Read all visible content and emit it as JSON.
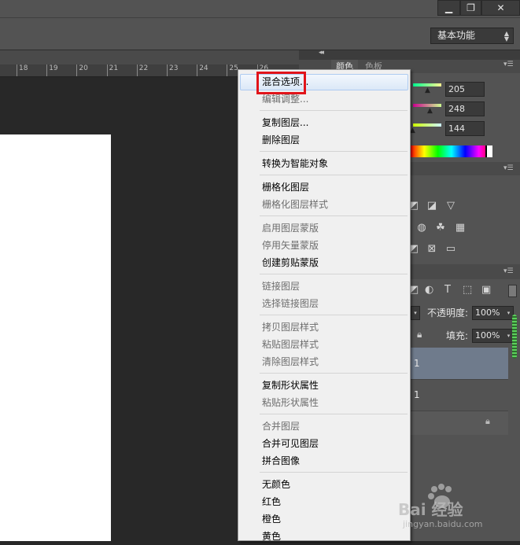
{
  "window": {
    "min_icon": "minimize-icon",
    "max_icon": "restore-icon",
    "close_icon": "close-icon",
    "min_glyph": "▁",
    "max_glyph": "❐",
    "close_glyph": "✕"
  },
  "options": {
    "workspace": "基本功能"
  },
  "ruler": {
    "ticks": [
      "18",
      "19",
      "20",
      "21",
      "22",
      "23",
      "24",
      "25",
      "26"
    ]
  },
  "panels": {
    "collapse_glyph": "◂◂",
    "tabs": [
      "颜色",
      "色板"
    ],
    "color": {
      "r": "205",
      "g": "248",
      "b": "144"
    },
    "layers": {
      "opacity_label": "不透明度:",
      "opacity_value": "100%",
      "fill_label": "填充:",
      "fill_value": "100%",
      "row1_text": "1",
      "row2_text": "1"
    }
  },
  "menu": {
    "groups": [
      [
        {
          "label": "混合选项...",
          "enabled": true,
          "highlighted": true
        },
        {
          "label": "编辑调整...",
          "enabled": false
        }
      ],
      [
        {
          "label": "复制图层...",
          "enabled": true
        },
        {
          "label": "删除图层",
          "enabled": true
        }
      ],
      [
        {
          "label": "转换为智能对象",
          "enabled": true
        }
      ],
      [
        {
          "label": "栅格化图层",
          "enabled": true
        },
        {
          "label": "栅格化图层样式",
          "enabled": false
        }
      ],
      [
        {
          "label": "启用图层蒙版",
          "enabled": false
        },
        {
          "label": "停用矢量蒙版",
          "enabled": false
        },
        {
          "label": "创建剪贴蒙版",
          "enabled": true
        }
      ],
      [
        {
          "label": "链接图层",
          "enabled": false
        },
        {
          "label": "选择链接图层",
          "enabled": false
        }
      ],
      [
        {
          "label": "拷贝图层样式",
          "enabled": false
        },
        {
          "label": "粘贴图层样式",
          "enabled": false
        },
        {
          "label": "清除图层样式",
          "enabled": false
        }
      ],
      [
        {
          "label": "复制形状属性",
          "enabled": true
        },
        {
          "label": "粘贴形状属性",
          "enabled": false
        }
      ],
      [
        {
          "label": "合并图层",
          "enabled": false
        },
        {
          "label": "合并可见图层",
          "enabled": true
        },
        {
          "label": "拼合图像",
          "enabled": true
        }
      ],
      [
        {
          "label": "无颜色",
          "enabled": true
        },
        {
          "label": "红色",
          "enabled": true
        },
        {
          "label": "橙色",
          "enabled": true
        },
        {
          "label": "黄色",
          "enabled": true
        }
      ]
    ]
  },
  "watermark": {
    "brand": "Bai 经验",
    "url": "jingyan.baidu.com"
  },
  "colors": {
    "accent_red": "#e1141a",
    "layer_selected": "#6f7b8c"
  }
}
